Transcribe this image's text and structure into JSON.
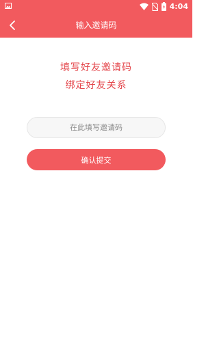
{
  "status_bar": {
    "time": "4:04",
    "icons": [
      "image-notification-icon",
      "wifi-icon",
      "no-sim-icon",
      "battery-icon"
    ]
  },
  "header": {
    "title": "输入邀请码",
    "back_icon": "chevron-left-icon"
  },
  "prompt": {
    "line1": "填写好友邀请码",
    "line2": "绑定好友关系"
  },
  "form": {
    "invite_placeholder": "在此填写邀请码",
    "invite_value": "",
    "confirm_label": "确认提交"
  },
  "colors": {
    "primary": "#f25a5e",
    "prompt_text": "#e4474c",
    "input_bg": "#f7f7f7",
    "input_border": "#e6e6e6",
    "placeholder": "#8a8a8a"
  }
}
